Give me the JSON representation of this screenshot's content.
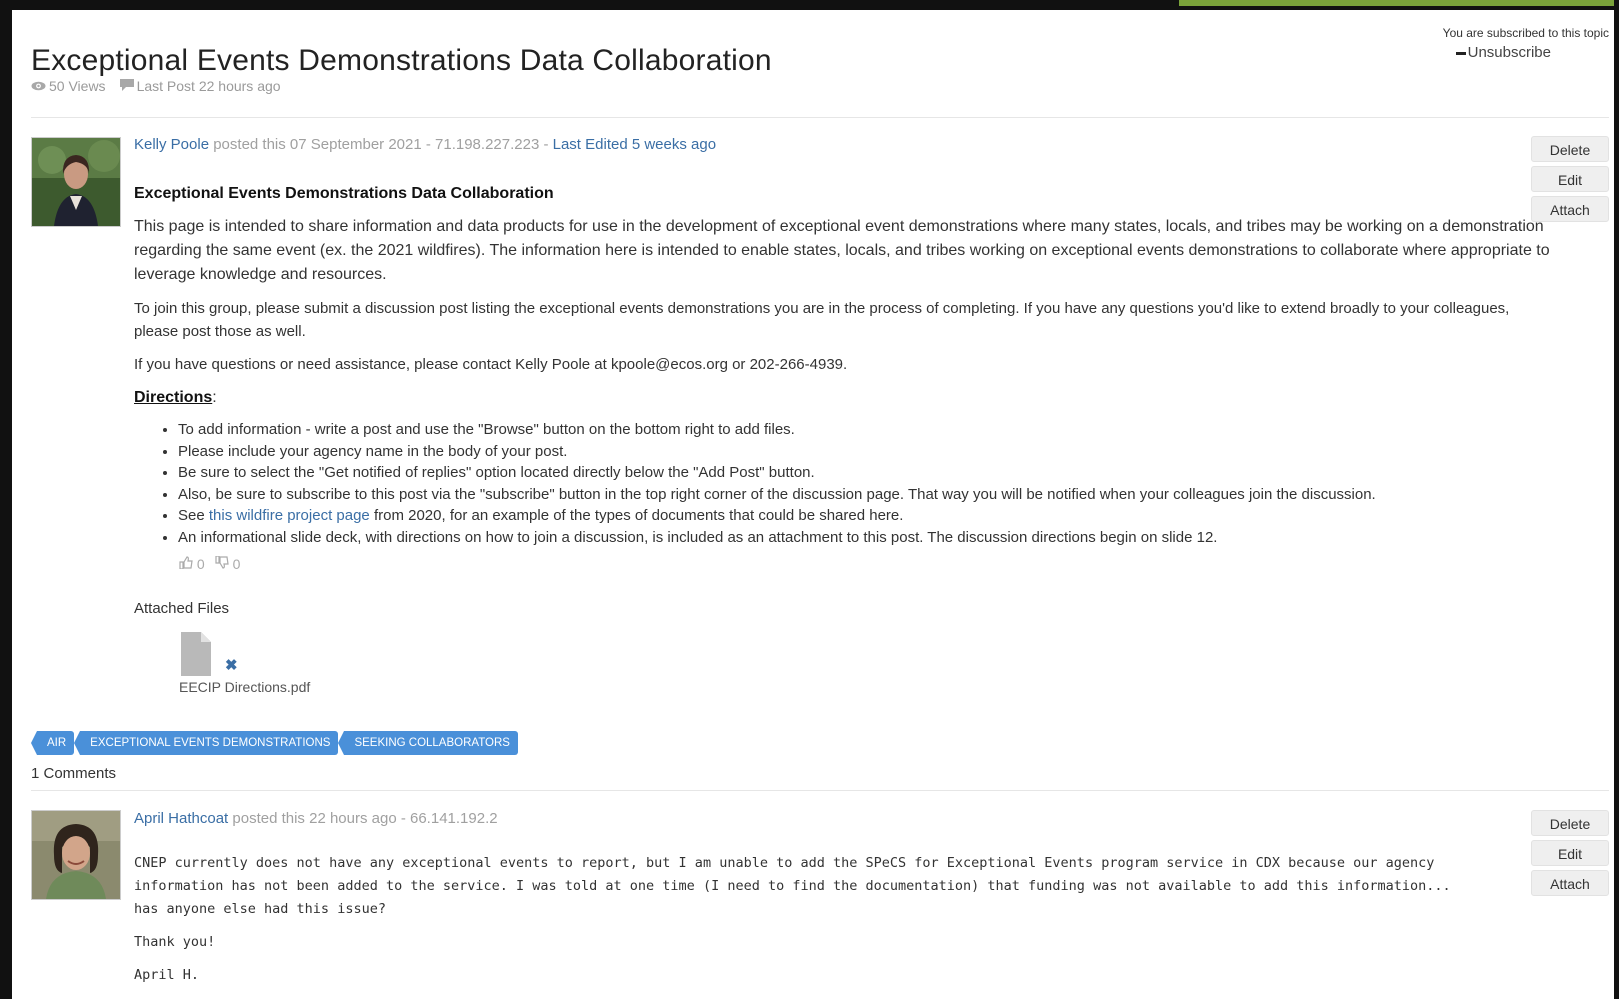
{
  "topic": {
    "title": "Exceptional Events Demonstrations Data Collaboration",
    "views": "50 Views",
    "last_post": "Last Post 22 hours ago",
    "subscribed_text": "You are subscribed to this topic",
    "unsubscribe_label": "Unsubscribe"
  },
  "post": {
    "author": "Kelly Poole",
    "posted_text": " posted this 07 September 2021 - 71.198.227.223 - ",
    "last_edited": "Last Edited 5 weeks ago",
    "actions": {
      "delete": "Delete",
      "edit": "Edit",
      "attach": "Attach"
    },
    "heading": "Exceptional Events Demonstrations Data Collaboration",
    "paragraphs": [
      "This page is intended to share information and data products for use in the development of exceptional event demonstrations where many states, locals, and tribes may be working on a demonstration regarding the same event (ex. the 2021 wildfires). The information here is intended to enable states, locals, and tribes working on exceptional events demonstrations to collaborate where appropriate to leverage knowledge and resources.",
      "To join this group, please submit a discussion post listing the exceptional events demonstrations you are in the process of completing. If you have any questions you'd like to extend broadly to your colleagues, please post those as well.",
      "If you have questions or need assistance, please contact Kelly Poole at kpoole@ecos.org or 202-266-4939."
    ],
    "directions_label": "Directions",
    "directions_colon": ":",
    "directions": [
      "To add information - write a post and use the \"Browse\" button on the bottom right to add files.",
      "Please include your agency name in the body of your post.",
      "Be sure to select the \"Get notified of replies\" option located directly below the \"Add Post\" button.",
      "Also, be sure to subscribe to this post via the \"subscribe\" button in the top right corner of the discussion page. That way you will be notified when your colleagues join the discussion.",
      "An informational slide deck, with directions on how to join a discussion, is included as an attachment to this post. The discussion directions begin on slide 12."
    ],
    "see_prefix": "See ",
    "see_link": "this wildfire project page",
    "see_suffix": " from 2020, for an example of the types of documents that could be shared here.",
    "likes": "0",
    "dislikes": "0",
    "attached_files_label": "Attached Files",
    "file_name": "EECIP Directions.pdf",
    "tags": [
      "AIR",
      "EXCEPTIONAL EVENTS DEMONSTRATIONS",
      "SEEKING COLLABORATORS"
    ]
  },
  "comments_count": "1 Comments",
  "comment": {
    "author": "April Hathcoat",
    "posted_text": " posted this 22 hours ago - 66.141.192.2",
    "actions": {
      "delete": "Delete",
      "edit": "Edit",
      "attach": "Attach"
    },
    "paragraphs": [
      "CNEP currently does not have any exceptional events to report, but I am unable to add the SPeCS for Exceptional Events program service in CDX because our agency information has not been added to the service.  I was told at one time (I need to find the documentation) that funding was not available to add this information... has anyone else had this issue?",
      "Thank you!",
      "April H."
    ]
  },
  "colors": {
    "link": "#3a6ea5",
    "tag": "#4a90d9",
    "frame": "#111111",
    "accent_green": "#7aa23a"
  }
}
